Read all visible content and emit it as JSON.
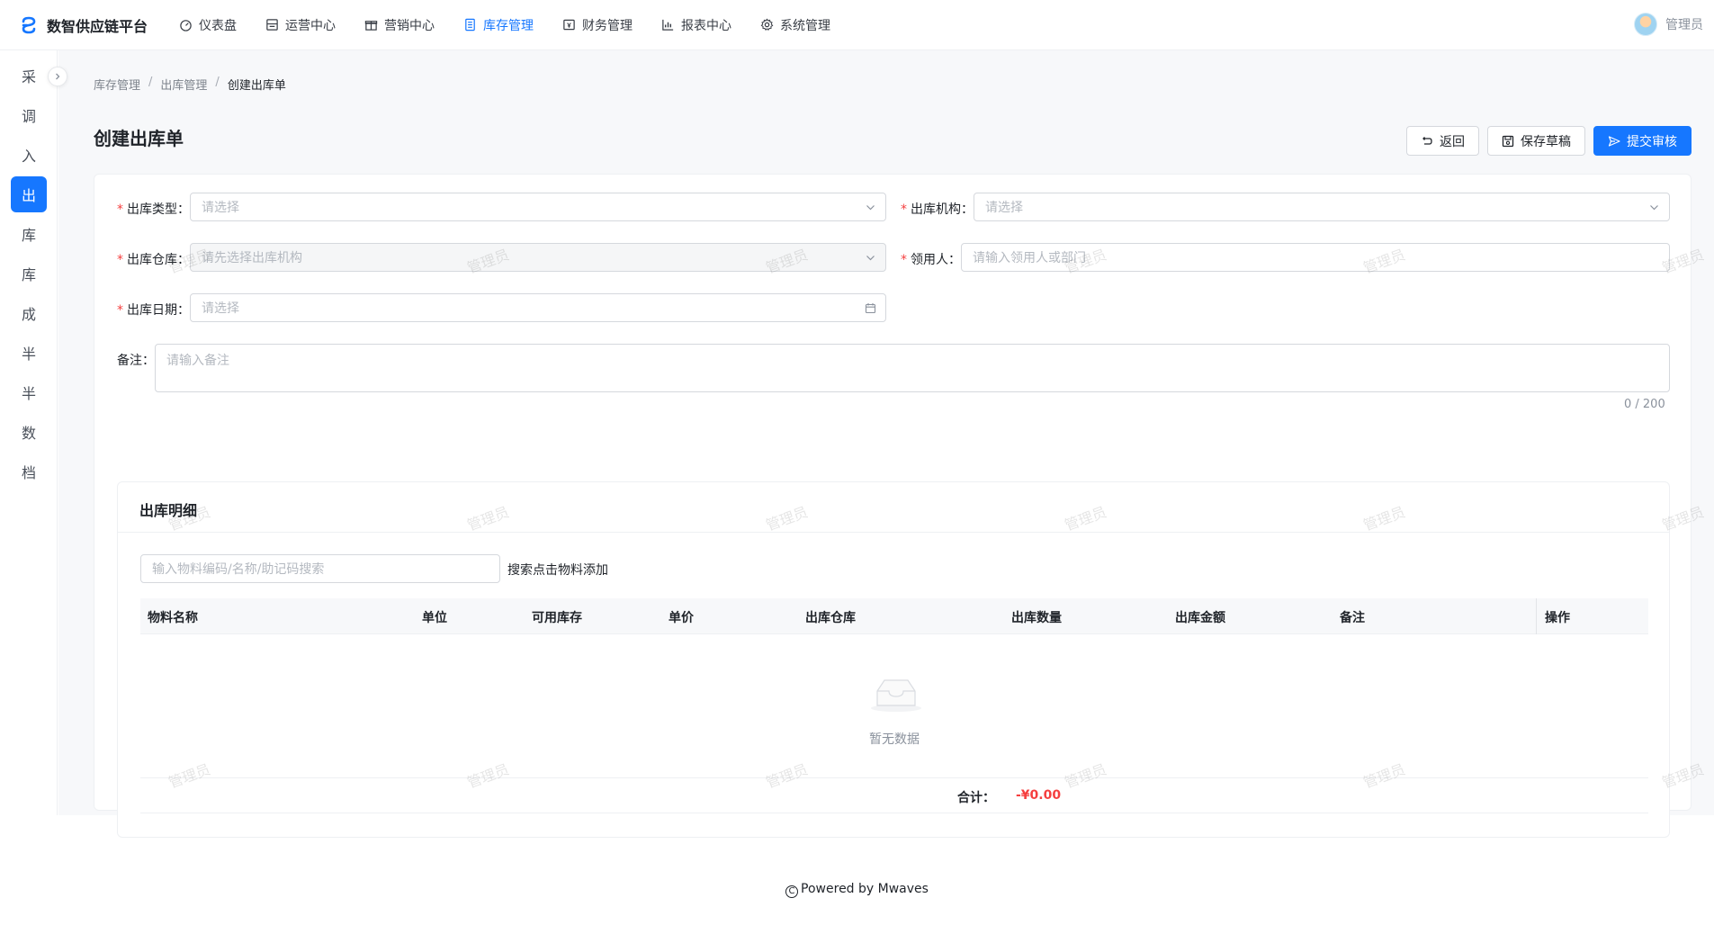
{
  "app": {
    "name": "数智供应链平台",
    "brand_color": "#1677ff"
  },
  "nav": [
    {
      "label": "仪表盘",
      "icon": "dashboard-icon"
    },
    {
      "label": "运营中心",
      "icon": "operations-icon"
    },
    {
      "label": "营销中心",
      "icon": "gift-icon"
    },
    {
      "label": "库存管理",
      "icon": "inventory-icon",
      "active": true
    },
    {
      "label": "财务管理",
      "icon": "finance-icon"
    },
    {
      "label": "报表中心",
      "icon": "chart-icon"
    },
    {
      "label": "系统管理",
      "icon": "gear-icon"
    }
  ],
  "user": {
    "name": "管理员"
  },
  "sidebar": [
    "采",
    "调",
    "入",
    "出",
    "库",
    "库",
    "成",
    "半",
    "半",
    "数",
    "档"
  ],
  "breadcrumb": [
    "库存管理",
    "出库管理",
    "创建出库单"
  ],
  "page": {
    "title": "创建出库单"
  },
  "actions": {
    "back": "返回",
    "save_draft": "保存草稿",
    "submit": "提交审核"
  },
  "form": {
    "type_label": "出库类型：",
    "type_placeholder": "请选择",
    "org_label": "出库机构：",
    "org_placeholder": "请选择",
    "warehouse_label": "出库仓库：",
    "warehouse_placeholder": "请先选择出库机构",
    "receiver_label": "领用人：",
    "receiver_placeholder": "请输入领用人或部门",
    "date_label": "出库日期：",
    "date_placeholder": "请选择",
    "remark_label": "备注：",
    "remark_placeholder": "请输入备注",
    "remark_counter": "0 / 200"
  },
  "detail": {
    "title": "出库明细",
    "search_placeholder": "输入物料编码/名称/助记码搜索",
    "search_tip": "搜索点击物料添加",
    "columns": [
      "物料名称",
      "单位",
      "可用库存",
      "单价",
      "出库仓库",
      "出库数量",
      "出库金额",
      "备注",
      "操作"
    ],
    "empty_text": "暂无数据",
    "total_label": "合计：",
    "total_value": "-¥0.00"
  },
  "footer": {
    "text": "Powered by Mwaves"
  },
  "watermark_text": "管理员"
}
